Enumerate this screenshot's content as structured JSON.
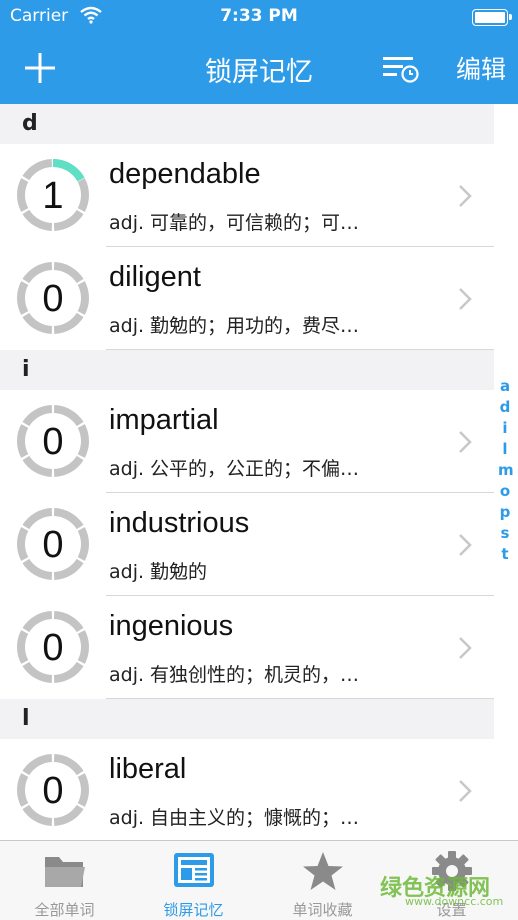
{
  "status": {
    "carrier": "Carrier",
    "time": "7:33 PM"
  },
  "nav": {
    "title": "锁屏记忆",
    "edit": "编辑"
  },
  "sections": [
    {
      "letter": "d",
      "items": [
        {
          "word": "dependable",
          "meaning": "adj. 可靠的，可信赖的；可…",
          "count": "1",
          "progress": 0.17
        },
        {
          "word": "diligent",
          "meaning": "adj. 勤勉的；用功的，费尽…",
          "count": "0",
          "progress": 0
        }
      ]
    },
    {
      "letter": "i",
      "items": [
        {
          "word": "impartial",
          "meaning": "adj. 公平的，公正的；不偏…",
          "count": "0",
          "progress": 0
        },
        {
          "word": "industrious",
          "meaning": "adj. 勤勉的",
          "count": "0",
          "progress": 0
        },
        {
          "word": "ingenious",
          "meaning": "adj. 有独创性的；机灵的，…",
          "count": "0",
          "progress": 0
        }
      ]
    },
    {
      "letter": "l",
      "items": [
        {
          "word": "liberal",
          "meaning": "adj. 自由主义的；慷慨的；…",
          "count": "0",
          "progress": 0
        }
      ]
    }
  ],
  "index": [
    "a",
    "d",
    "i",
    "l",
    "m",
    "o",
    "p",
    "s",
    "t"
  ],
  "tabs": [
    {
      "label": "全部单词",
      "icon": "folder-icon"
    },
    {
      "label": "锁屏记忆",
      "icon": "lockscreen-icon"
    },
    {
      "label": "单词收藏",
      "icon": "star-icon"
    },
    {
      "label": "设置",
      "icon": "gear-icon"
    }
  ],
  "watermark": {
    "text": "绿色资源网",
    "sub": "www.downcc.com"
  },
  "colors": {
    "accent": "#2e9be8",
    "ring": "#c4c4c4",
    "ring_progress": "#5fe0c4"
  }
}
